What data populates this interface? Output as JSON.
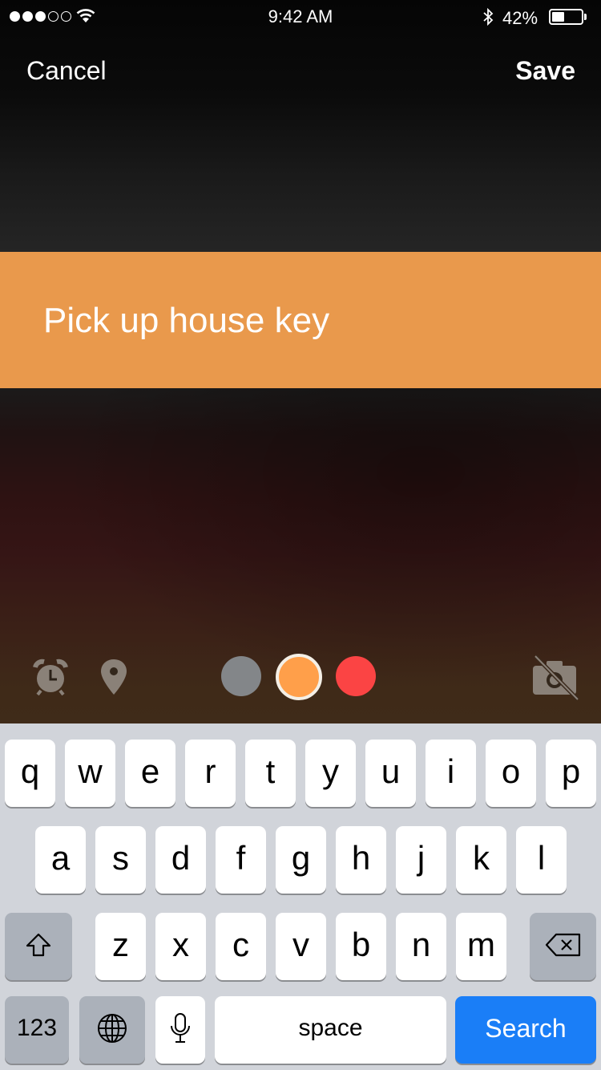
{
  "status_bar": {
    "time": "9:42 AM",
    "battery_percent": "42%",
    "battery_level": 0.42,
    "signal_bars_filled": 3,
    "signal_bars_total": 5,
    "icons": [
      "wifi-icon",
      "bluetooth-icon",
      "battery-icon"
    ]
  },
  "nav": {
    "cancel_label": "Cancel",
    "save_label": "Save"
  },
  "task": {
    "text": "Pick up house key",
    "band_color": "#e9994c"
  },
  "toolbar": {
    "icons": [
      "alarm-clock-icon",
      "location-pin-icon",
      "camera-off-icon"
    ],
    "colors": [
      {
        "name": "gray",
        "hex": "#838689",
        "selected": false
      },
      {
        "name": "orange",
        "hex": "#ff9f4a",
        "selected": true
      },
      {
        "name": "red",
        "hex": "#fb4444",
        "selected": false
      }
    ]
  },
  "keyboard": {
    "row1": [
      "q",
      "w",
      "e",
      "r",
      "t",
      "y",
      "u",
      "i",
      "o",
      "p"
    ],
    "row2": [
      "a",
      "s",
      "d",
      "f",
      "g",
      "h",
      "j",
      "k",
      "l"
    ],
    "row3": [
      "z",
      "x",
      "c",
      "v",
      "b",
      "n",
      "m"
    ],
    "numbers_label": "123",
    "space_label": "space",
    "search_label": "Search",
    "accent": "#1a7ef7"
  }
}
